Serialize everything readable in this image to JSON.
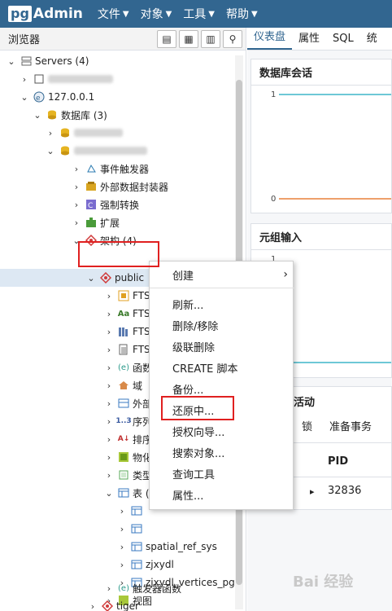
{
  "navbar": {
    "logo_box": "pg",
    "logo_text": "Admin",
    "menus": [
      "文件",
      "对象",
      "工具",
      "帮助"
    ]
  },
  "browser": {
    "title": "浏览器"
  },
  "tree": {
    "servers": "Servers (4)",
    "server_ip": "127.0.0.1",
    "databases": "数据库 (3)",
    "event_triggers": "事件触发器",
    "fdw": "外部数据封装器",
    "casts": "强制转换",
    "extensions": "扩展",
    "schemas": "架构 (4)",
    "public": "public",
    "fts1": "FTS",
    "fts2": "FTS",
    "fts3": "FTS",
    "fts4": "FTS",
    "functions": "函数",
    "domains": "域",
    "foreign": "外部",
    "sequences": "序列",
    "collations": "排序",
    "matviews": "物化",
    "types": "类型",
    "tables": "表 (",
    "t_spatial": "spatial_ref_sys",
    "t_zjxydl": "zjxydl",
    "t_vertices": "zjxydl_vertices_pg",
    "views": "视图",
    "trigger_functions": "触发器函数",
    "tiger": "tiger"
  },
  "right": {
    "tabs": [
      "仪表盘",
      "属性",
      "SQL",
      "统"
    ],
    "card1_title": "数据库会话",
    "card1_y_top": "1",
    "card1_y_bottom": "0",
    "card2_title": "元组输入",
    "card2_y_top": "1",
    "card3_title": "活动",
    "card3_cols": [
      "锁",
      "准备事务"
    ],
    "table_header": "PID",
    "table_value": "32836"
  },
  "context_menu": {
    "items": [
      "创建",
      "刷新...",
      "删除/移除",
      "级联删除",
      "CREATE 脚本",
      "备份...",
      "还原中...",
      "授权向导...",
      "搜索对象...",
      "查询工具",
      "属性..."
    ]
  },
  "watermark": "Bai 经验",
  "colors": {
    "navbar": "#326690",
    "highlight_box": "#e02020",
    "selected_row": "#dde8f3",
    "chart_line_teal": "#3fb6c8",
    "chart_line_orange": "#e8803a"
  }
}
